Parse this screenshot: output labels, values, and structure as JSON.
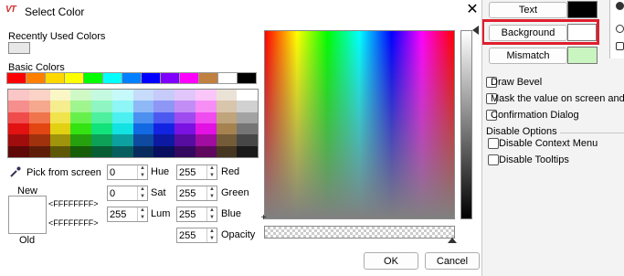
{
  "dialog": {
    "title": "Select Color",
    "logo_text": "VT",
    "close_symbol": "✕",
    "recently_used_label": "Recently Used Colors",
    "basic_colors_label": "Basic Colors",
    "basic_colors": [
      "#ff0000",
      "#ff8000",
      "#ffd800",
      "#ffff00",
      "#00ff00",
      "#00ffff",
      "#0080ff",
      "#0000ff",
      "#8000ff",
      "#ff00ff",
      "#c08040",
      "#ffffff",
      "#000000"
    ],
    "pick_from_screen": "Pick from screen",
    "new_label": "New",
    "old_label": "Old",
    "new_value": "<FFFFFFFF>",
    "old_value": "<FFFFFFFF>",
    "hue_label": "Hue",
    "hue_value": "0",
    "sat_label": "Sat",
    "sat_value": "0",
    "lum_label": "Lum",
    "lum_value": "255",
    "red_label": "Red",
    "red_value": "255",
    "green_label": "Green",
    "green_value": "255",
    "blue_label": "Blue",
    "blue_value": "255",
    "opacity_label": "Opacity",
    "opacity_value": "255",
    "ok_label": "OK",
    "cancel_label": "Cancel"
  },
  "background_app": {
    "text_button": "Text",
    "background_button": "Background",
    "mismatch_button": "Mismatch",
    "draw_bevel": "Draw Bevel",
    "mask_value": "Mask the value on screen and in lo",
    "confirmation_dialog": "Confirmation Dialog",
    "disable_options": "Disable Options",
    "disable_context_menu": "Disable Context Menu",
    "disable_tooltips": "Disable Tooltips",
    "text_swatch_color": "#000000",
    "background_swatch_color": "#ffffff",
    "mismatch_swatch_color": "#c8f5c0",
    "highlight_color": "#e01e2e"
  }
}
